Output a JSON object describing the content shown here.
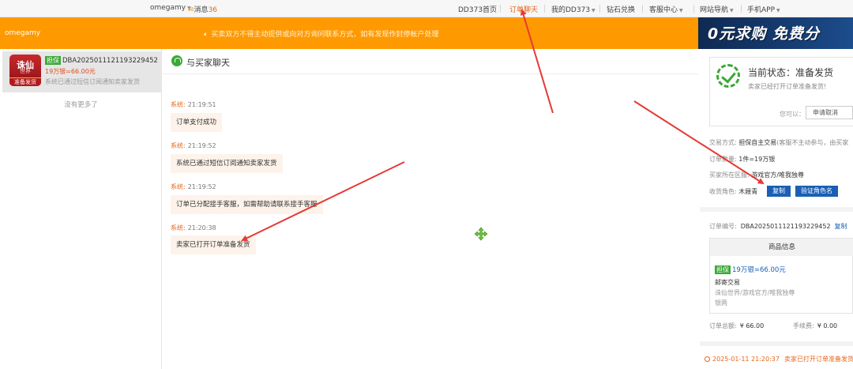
{
  "topbar": {
    "username": "omegamy",
    "messages_label": "消息",
    "messages_count": "36",
    "links": [
      "DD373首页",
      "订单聊天",
      "我的DD373",
      "钻石兑换",
      "客服中心",
      "网站导航",
      "手机APP"
    ],
    "active_color": "#e8661a"
  },
  "notice_bar": {
    "username": "omegamy",
    "notice": "买卖双方不得主动提供或向对方询问联系方式，如有发现作封停帐户处理",
    "banner_text": "0元求购 免费分",
    "bg_color": "#ff9900"
  },
  "sessions": {
    "items": [
      {
        "thumb_title": "诛仙",
        "thumb_sub": "世界",
        "thumb_tag": "准备发货",
        "badge": "担保",
        "order_no": "DBA20250111211932294​52",
        "price": "19万银=66.00元",
        "last_msg": "系统已通过短信订阅通知卖家发货"
      }
    ],
    "no_more": "没有更多了"
  },
  "chat": {
    "title": "与买家聊天",
    "messages": [
      {
        "sender": "系统:",
        "time": "21:19:51",
        "text": "订单支付成功"
      },
      {
        "sender": "系统:",
        "time": "21:19:52",
        "text": "系统已通过短信订阅通知卖家发货"
      },
      {
        "sender": "系统:",
        "time": "21:19:52",
        "text": "订单已分配接手客服，如需帮助请联系接手客服"
      },
      {
        "sender": "系统:",
        "time": "21:20:38",
        "text": "卖家已打开订单准备发货"
      }
    ]
  },
  "order_panel": {
    "status_title": "当前状态：准备发货",
    "status_sub": "卖家已经打开订单准备发货!",
    "cancel_label": "您可以：",
    "cancel_button": "申请取消",
    "trade_mode_label": "交易方式:",
    "trade_mode_value": "担保自主交易",
    "trade_mode_note": "(客服不主动参与，由买家",
    "quantity_label": "订单数量:",
    "quantity_value": "1件=19万银",
    "buyer_area_label": "买家所在区服:",
    "buyer_area_value": "游戏官方/唯我独尊",
    "receiver_label": "收货角色:",
    "receiver_value": "木屐青",
    "copy_button": "复制",
    "verify_button": "验证角色名",
    "order_no_label": "订单编号:",
    "order_no_value": "DBA20250111211932294​52",
    "order_no_copy": "复制",
    "goods_header": "商品信息",
    "goods_badge": "担保",
    "goods_price": "19万银=66.00元",
    "goods_mode": "邮寄交易",
    "goods_area": "诛仙世界/游戏官方/唯我独尊",
    "goods_type": "银两",
    "total_label": "订单总额:",
    "total_value": "¥ 66.00",
    "fee_label": "手续费:",
    "fee_value": "¥ 0.00",
    "log_time": "2025-01-11 21:20:37",
    "log_text": "卖家已打开订单准备发货"
  },
  "colors": {
    "accent": "#e8661a",
    "green": "#3aa935",
    "blue": "#1a5fb4",
    "arrow": "#e53935"
  }
}
